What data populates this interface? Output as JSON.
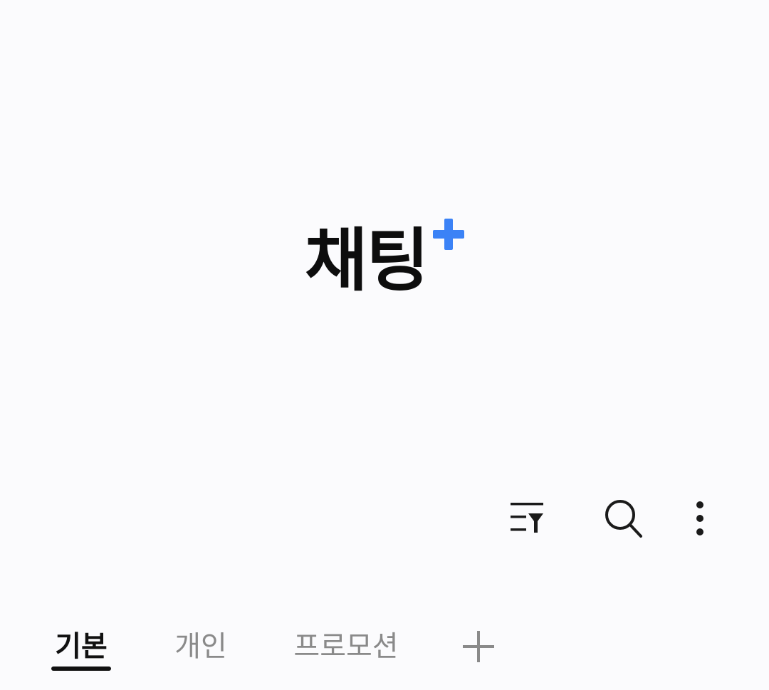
{
  "app": {
    "title": "채팅",
    "accent_color": "#3b82f6"
  },
  "toolbar": {
    "filter_icon": "filter-list-icon",
    "search_icon": "search-icon",
    "more_icon": "more-vertical-icon"
  },
  "tabs": [
    {
      "label": "기본",
      "active": true
    },
    {
      "label": "개인",
      "active": false
    },
    {
      "label": "프로모션",
      "active": false
    }
  ],
  "add_tab_icon": "plus-icon"
}
